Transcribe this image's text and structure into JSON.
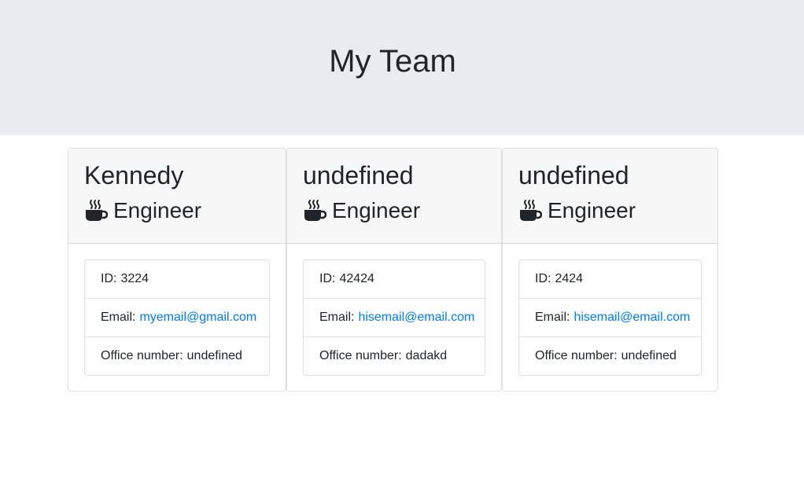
{
  "header": {
    "title": "My Team"
  },
  "labels": {
    "id": "ID:",
    "email": "Email:",
    "office": "Office number:"
  },
  "icon": "coffee-mug-icon",
  "colors": {
    "link": "#007bff",
    "jumbotron": "#e9ecef",
    "card_header": "#f7f7f7"
  },
  "cards": [
    {
      "name": "Kennedy",
      "role": "Engineer",
      "id": "3224",
      "email": "myemail@gmail.com",
      "office": "undefined"
    },
    {
      "name": "undefined",
      "role": "Engineer",
      "id": "42424",
      "email": "hisemail@email.com",
      "office": "dadakd"
    },
    {
      "name": "undefined",
      "role": "Engineer",
      "id": "2424",
      "email": "hisemail@email.com",
      "office": "undefined"
    }
  ]
}
